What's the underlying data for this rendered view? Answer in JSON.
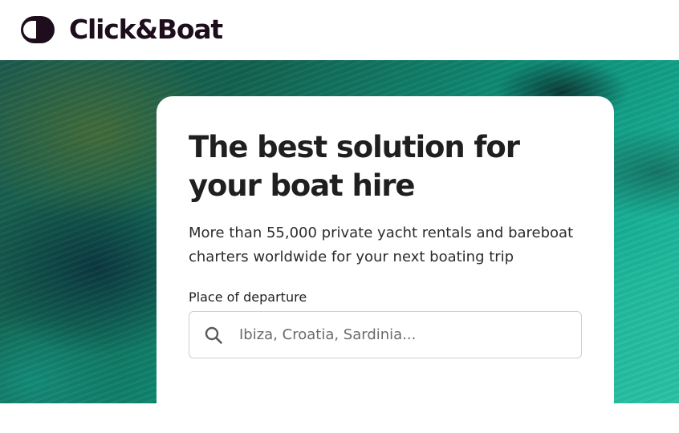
{
  "header": {
    "brand": "Click&Boat",
    "logo_icon": "click-and-boat-logo-icon",
    "brand_color": "#1e0d1c"
  },
  "hero": {
    "title": "The best solution for your boat hire",
    "subtitle": "More than 55,000 private yacht rentals and bareboat charters worldwide for your next boating trip",
    "search": {
      "label": "Place of departure",
      "placeholder": "Ibiza, Croatia, Sardinia...",
      "value": "",
      "icon": "search-icon"
    }
  }
}
